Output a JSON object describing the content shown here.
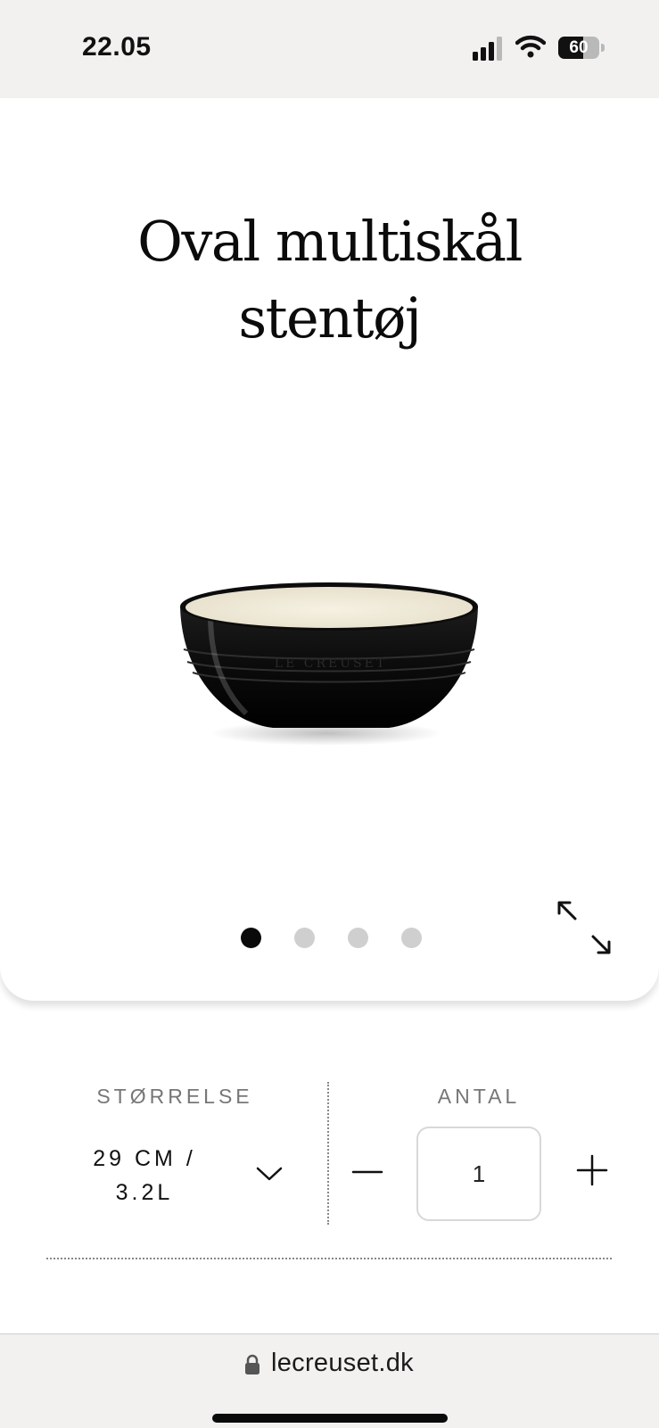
{
  "status_bar": {
    "time": "22.05",
    "battery_percent": 60,
    "battery_label": "60",
    "icons": [
      "cellular-signal-icon",
      "wifi-icon",
      "battery-icon"
    ]
  },
  "product": {
    "title_line1": "Oval multiskål",
    "title_line2": "stentøj",
    "image_icon": "black-stoneware-oval-bowl",
    "image_brand_text": "LE CREUSET",
    "colors": {
      "bowl_exterior": "#0d0d0d",
      "bowl_interior": "#efe9d8"
    }
  },
  "gallery": {
    "slides": 4,
    "active_index": 0,
    "expand_icon": "expand-arrows-icon"
  },
  "options": {
    "size_label": "STØRRELSE",
    "size_value_line1": "29 CM /",
    "size_value_line2": "3.2L",
    "size_dropdown_icon": "chevron-down-icon",
    "quantity_label": "ANTAL",
    "quantity_value": "1",
    "minus_icon": "minus-icon",
    "plus_icon": "plus-icon"
  },
  "browser": {
    "url": "lecreuset.dk",
    "lock_icon": "lock-icon"
  }
}
